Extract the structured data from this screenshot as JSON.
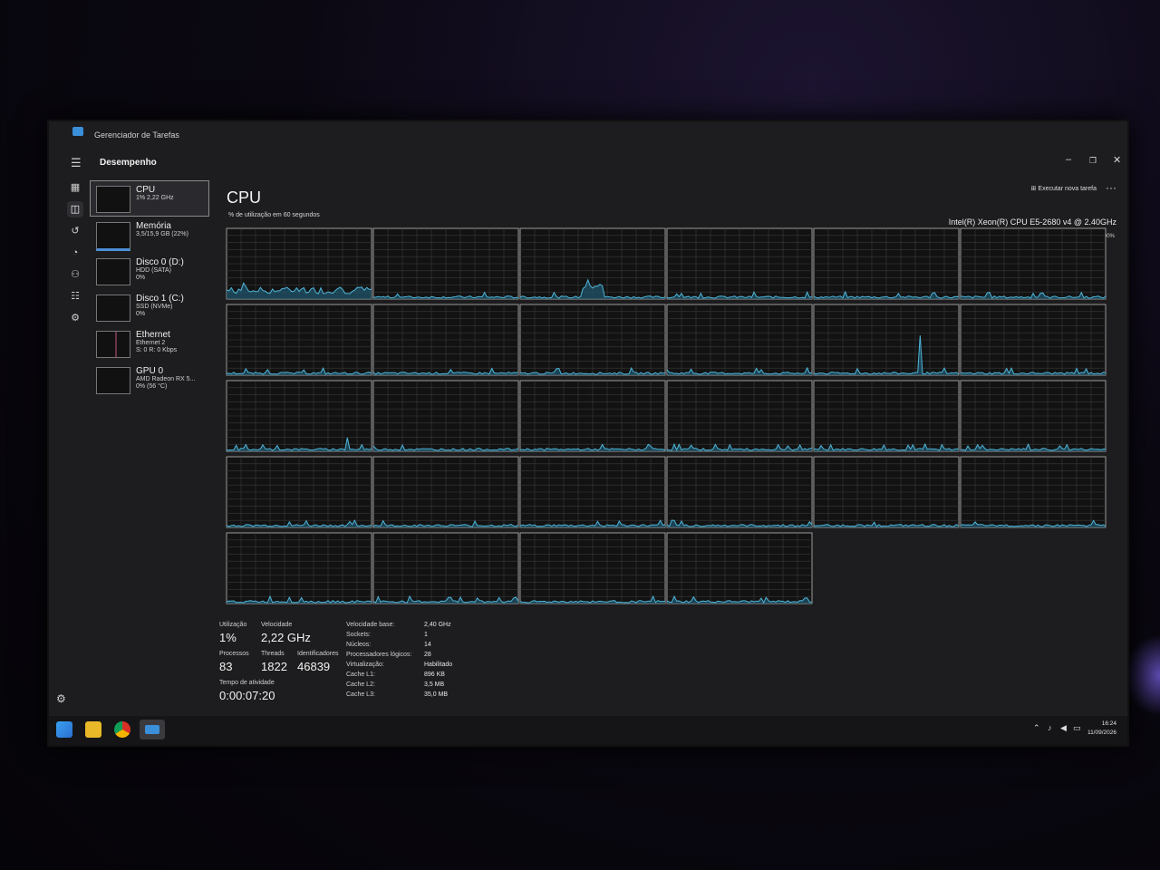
{
  "window": {
    "app_title": "Gerenciador de Tarefas",
    "section_title": "Desempenho",
    "minimize_glyph": "–",
    "restore_glyph": "❐",
    "close_glyph": "✕"
  },
  "toolbar": {
    "new_task_label": "Executar nova tarefa",
    "more_glyph": "···"
  },
  "sidebar": {
    "items": [
      {
        "name": "CPU",
        "sub": "1% 2,22 GHz",
        "sub2": ""
      },
      {
        "name": "Memória",
        "sub": "3,5/15,9 GB (22%)",
        "sub2": ""
      },
      {
        "name": "Disco 0 (D:)",
        "sub": "HDD (SATA)",
        "sub2": "0%"
      },
      {
        "name": "Disco 1 (C:)",
        "sub": "SSD (NVMe)",
        "sub2": "0%"
      },
      {
        "name": "Ethernet",
        "sub": "Ethernet 2",
        "sub2": "S: 0 R: 0 Kbps"
      },
      {
        "name": "GPU 0",
        "sub": "AMD Radeon RX 5...",
        "sub2": "0% (56 °C)"
      }
    ]
  },
  "cpu": {
    "title": "CPU",
    "util_caption": "% de utilização em 60 segundos",
    "model": "Intel(R) Xeon(R) CPU E5-2680 v4 @ 2.40GHz",
    "max_label": "100%",
    "graph_count": 28,
    "colors": {
      "line": "#4fb6d8",
      "fill": "#1f5870",
      "grid": "#3a3a3a",
      "border": "#9a9a9a",
      "bg": "#121213"
    }
  },
  "stats": {
    "utilizacao_label": "Utilização",
    "utilizacao_value": "1%",
    "velocidade_label": "Velocidade",
    "velocidade_value": "2,22 GHz",
    "processos_label": "Processos",
    "processos_value": "83",
    "threads_label": "Threads",
    "threads_value": "1822",
    "identificadores_label": "Identificadores",
    "identificadores_value": "46839",
    "tempo_label": "Tempo de atividade",
    "tempo_value": "0:00:07:20",
    "details": [
      {
        "label": "Velocidade base:",
        "value": "2,40 GHz"
      },
      {
        "label": "Sockets:",
        "value": "1"
      },
      {
        "label": "Núcleos:",
        "value": "14"
      },
      {
        "label": "Processadores lógicos:",
        "value": "28"
      },
      {
        "label": "Virtualização:",
        "value": "Habilitado"
      },
      {
        "label": "Cache L1:",
        "value": "896 KB"
      },
      {
        "label": "Cache L2:",
        "value": "3,5 MB"
      },
      {
        "label": "Cache L3:",
        "value": "35,0 MB"
      }
    ]
  },
  "taskbar": {
    "time": "16:24",
    "date": "11/09/2026"
  }
}
